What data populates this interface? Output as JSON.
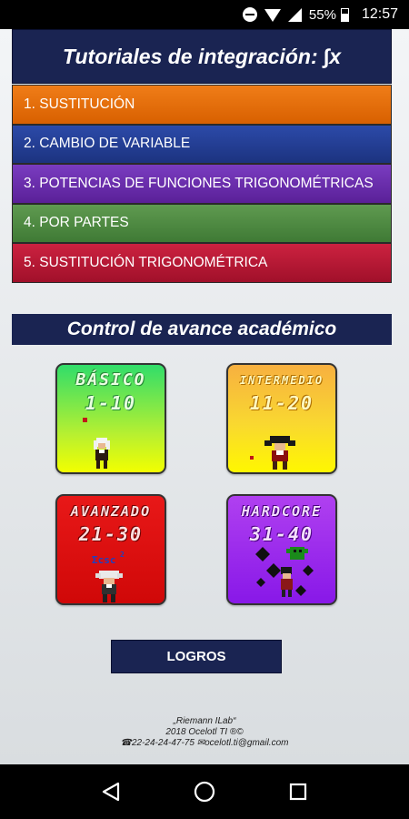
{
  "status_bar": {
    "battery": "55%",
    "time": "12:57"
  },
  "header": {
    "title": "Tutoriales de integración: ∫x"
  },
  "tutorials": [
    {
      "label": "1. SUSTITUCIÓN",
      "color": "#e86e0c"
    },
    {
      "label": "2. CAMBIO DE VARIABLE",
      "color": "#2340a0"
    },
    {
      "label": "3. POTENCIAS DE FUNCIONES TRIGONOMÉTRICAS",
      "color": "#6a2db0"
    },
    {
      "label": "4. POR PARTES",
      "color": "#4f8a44"
    },
    {
      "label": "5. SUSTITUCIÓN TRIGONOMÉTRICA",
      "color": "#b81836"
    }
  ],
  "progress_section": {
    "title": "Control de avance académico",
    "levels": [
      {
        "name": "BÁSICO",
        "range": "1-10",
        "color": "#7be84a"
      },
      {
        "name": "INTERMEDIO",
        "range": "11-20",
        "color": "#f9d22e"
      },
      {
        "name": "AVANZADO",
        "range": "21-30",
        "color": "#e01010"
      },
      {
        "name": "HARDCORE",
        "range": "31-40",
        "color": "#a030f0"
      }
    ]
  },
  "achievements_button": "LOGROS",
  "footer": {
    "line1": "„Riemann ILab“",
    "line2": "2018 Ocelotl TI ®©",
    "line3": "☎22-24-24-47-75 ✉ocelotl.ti@gmail.com"
  },
  "icons": {
    "dnd": "do-not-disturb-icon",
    "wifi": "wifi-icon",
    "signal": "cell-signal-icon",
    "battery": "battery-icon",
    "back": "back-icon",
    "home": "home-icon",
    "recents": "recents-icon"
  }
}
